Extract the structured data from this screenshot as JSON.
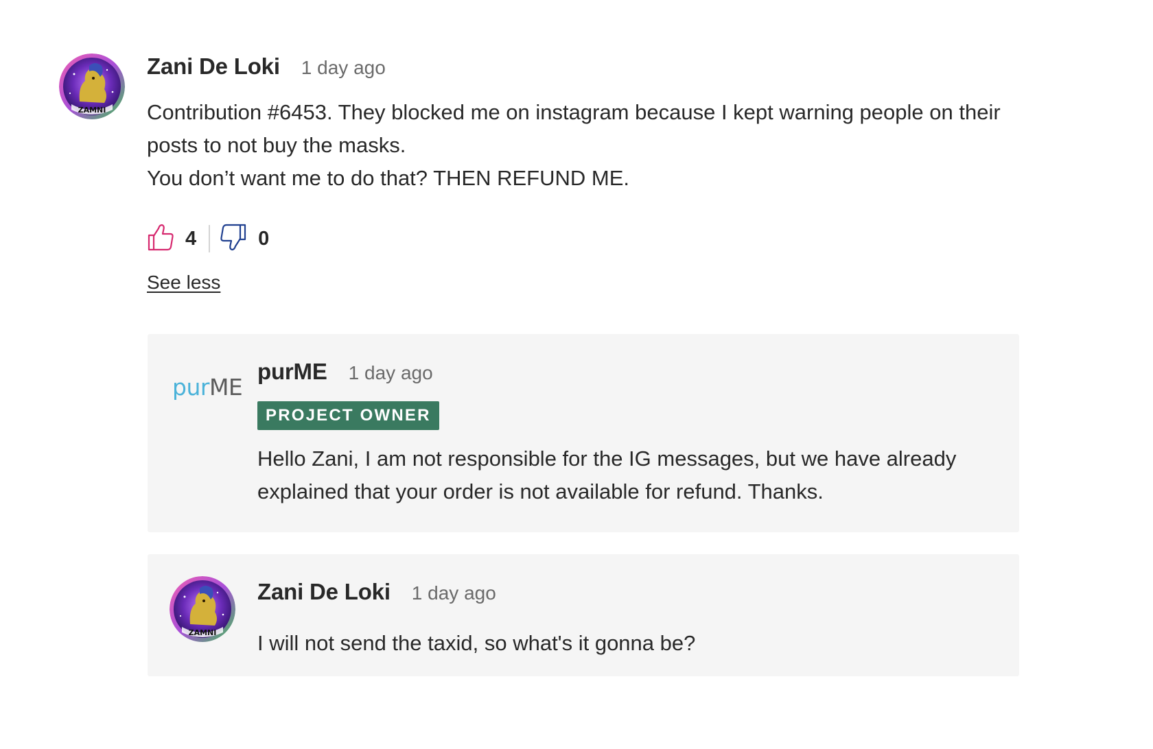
{
  "comment": {
    "author": "Zani De Loki",
    "timestamp": "1 day ago",
    "lines": [
      "Contribution #6453. They blocked me on instagram because I kept warning people on their posts to not buy the masks.",
      "You don’t want me to do that? THEN REFUND ME."
    ],
    "upvotes": "4",
    "downvotes": "0",
    "see_less_label": "See less",
    "avatar_text": "ZAMNI"
  },
  "replies": [
    {
      "author": "purME",
      "timestamp": "1 day ago",
      "badge": "PROJECT OWNER",
      "logo": {
        "part1": "pur",
        "part2": "ME"
      },
      "text": "Hello Zani, I am not responsible for the IG messages, but we have already explained that your order is not available for refund. Thanks."
    },
    {
      "author": "Zani De Loki",
      "timestamp": "1 day ago",
      "text": "I will not send the taxid, so what's it gonna be?",
      "avatar_text": "ZAMNI"
    }
  ],
  "colors": {
    "upvote_icon": "#d6286e",
    "downvote_icon": "#1f3f8f",
    "badge_bg": "#3a7a60",
    "reply_bg": "#f5f5f5",
    "logo_pur": "#4ab2d9",
    "logo_me": "#5b5b5b"
  },
  "icons": {
    "upvote": "thumbs-up-icon",
    "downvote": "thumbs-down-icon"
  }
}
